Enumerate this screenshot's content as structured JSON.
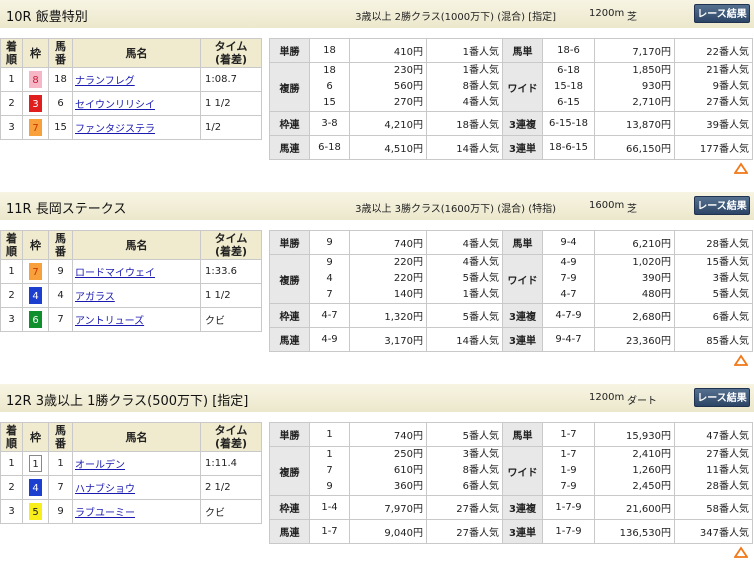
{
  "headers": {
    "finish": "着順",
    "gate": "枠",
    "horse_no": "馬番",
    "horse_name": "馬名",
    "time": "タイム(着差)",
    "finish_l1": "着",
    "finish_l2": "順",
    "horse_no_l1": "馬",
    "horse_no_l2": "番",
    "time_l1": "タイム",
    "time_l2": "(着差)"
  },
  "button_label": "レース結果",
  "colors": {
    "header_bg": "#f0ebcf",
    "button_bg": "#2c4566",
    "link": "#1a1ab0",
    "up_icon": "#f07818"
  },
  "races": [
    {
      "title": "10R 飯豊特別",
      "conditions": "3歳以上 2勝クラス(1000万下) (混合) [指定]",
      "distance": "1200m",
      "surface": "芝",
      "results": [
        {
          "finish": "1",
          "gate": "8",
          "gate_bg": "#f6b6c6",
          "gate_fg": "#c41e3a",
          "horse_no": "18",
          "name": "ナランフレグ",
          "time": "1:08.7"
        },
        {
          "finish": "2",
          "gate": "3",
          "gate_bg": "#e01e1e",
          "gate_fg": "#ffffff",
          "horse_no": "6",
          "name": "セイウンリリシイ",
          "time": "1 1/2"
        },
        {
          "finish": "3",
          "gate": "7",
          "gate_bg": "#f7a03c",
          "gate_fg": "#c83800",
          "horse_no": "15",
          "name": "ファンタジステラ",
          "time": "1/2"
        }
      ],
      "payouts": {
        "tansho": {
          "label": "単勝",
          "combos": [
            "18"
          ],
          "yen": [
            "410円"
          ],
          "pop": [
            "1番人気"
          ]
        },
        "fukusho": {
          "label": "複勝",
          "combos": [
            "18",
            "6",
            "15"
          ],
          "yen": [
            "230円",
            "560円",
            "270円"
          ],
          "pop": [
            "1番人気",
            "8番人気",
            "4番人気"
          ]
        },
        "wakuren": {
          "label": "枠連",
          "combos": [
            "3-8"
          ],
          "yen": [
            "4,210円"
          ],
          "pop": [
            "18番人気"
          ]
        },
        "umaren": {
          "label": "馬連",
          "combos": [
            "6-18"
          ],
          "yen": [
            "4,510円"
          ],
          "pop": [
            "14番人気"
          ]
        },
        "umatan": {
          "label": "馬単",
          "combos": [
            "18-6"
          ],
          "yen": [
            "7,170円"
          ],
          "pop": [
            "22番人気"
          ]
        },
        "wide": {
          "label": "ワイド",
          "combos": [
            "6-18",
            "15-18",
            "6-15"
          ],
          "yen": [
            "1,850円",
            "930円",
            "2,710円"
          ],
          "pop": [
            "21番人気",
            "9番人気",
            "27番人気"
          ]
        },
        "sanrenpuku": {
          "label": "3連複",
          "combos": [
            "6-15-18"
          ],
          "yen": [
            "13,870円"
          ],
          "pop": [
            "39番人気"
          ]
        },
        "sanrentan": {
          "label": "3連単",
          "combos": [
            "18-6-15"
          ],
          "yen": [
            "66,150円"
          ],
          "pop": [
            "177番人気"
          ]
        }
      }
    },
    {
      "title": "11R 長岡ステークス",
      "conditions": "3歳以上 3勝クラス(1600万下) (混合) (特指)",
      "distance": "1600m",
      "surface": "芝",
      "results": [
        {
          "finish": "1",
          "gate": "7",
          "gate_bg": "#f7a03c",
          "gate_fg": "#c83800",
          "horse_no": "9",
          "name": "ロードマイウェイ",
          "time": "1:33.6"
        },
        {
          "finish": "2",
          "gate": "4",
          "gate_bg": "#1c3fd0",
          "gate_fg": "#ffffff",
          "horse_no": "4",
          "name": "アガラス",
          "time": "1 1/2"
        },
        {
          "finish": "3",
          "gate": "6",
          "gate_bg": "#10902c",
          "gate_fg": "#ffffff",
          "horse_no": "7",
          "name": "アントリューズ",
          "time": "クビ"
        }
      ],
      "payouts": {
        "tansho": {
          "label": "単勝",
          "combos": [
            "9"
          ],
          "yen": [
            "740円"
          ],
          "pop": [
            "4番人気"
          ]
        },
        "fukusho": {
          "label": "複勝",
          "combos": [
            "9",
            "4",
            "7"
          ],
          "yen": [
            "220円",
            "220円",
            "140円"
          ],
          "pop": [
            "4番人気",
            "5番人気",
            "1番人気"
          ]
        },
        "wakuren": {
          "label": "枠連",
          "combos": [
            "4-7"
          ],
          "yen": [
            "1,320円"
          ],
          "pop": [
            "5番人気"
          ]
        },
        "umaren": {
          "label": "馬連",
          "combos": [
            "4-9"
          ],
          "yen": [
            "3,170円"
          ],
          "pop": [
            "14番人気"
          ]
        },
        "umatan": {
          "label": "馬単",
          "combos": [
            "9-4"
          ],
          "yen": [
            "6,210円"
          ],
          "pop": [
            "28番人気"
          ]
        },
        "wide": {
          "label": "ワイド",
          "combos": [
            "4-9",
            "7-9",
            "4-7"
          ],
          "yen": [
            "1,020円",
            "390円",
            "480円"
          ],
          "pop": [
            "15番人気",
            "3番人気",
            "5番人気"
          ]
        },
        "sanrenpuku": {
          "label": "3連複",
          "combos": [
            "4-7-9"
          ],
          "yen": [
            "2,680円"
          ],
          "pop": [
            "6番人気"
          ]
        },
        "sanrentan": {
          "label": "3連単",
          "combos": [
            "9-4-7"
          ],
          "yen": [
            "23,360円"
          ],
          "pop": [
            "85番人気"
          ]
        }
      }
    },
    {
      "title": "12R 3歳以上 1勝クラス(500万下) [指定]",
      "conditions": "",
      "distance": "1200m",
      "surface": "ダート",
      "results": [
        {
          "finish": "1",
          "gate": "1",
          "gate_bg": "#ffffff",
          "gate_fg": "#222222",
          "horse_no": "1",
          "name": "オールデン",
          "time": "1:11.4"
        },
        {
          "finish": "2",
          "gate": "4",
          "gate_bg": "#1c3fd0",
          "gate_fg": "#ffffff",
          "horse_no": "7",
          "name": "ハナブショウ",
          "time": "2 1/2"
        },
        {
          "finish": "3",
          "gate": "5",
          "gate_bg": "#f8ee1a",
          "gate_fg": "#222222",
          "horse_no": "9",
          "name": "ラブユーミー",
          "time": "クビ"
        }
      ],
      "payouts": {
        "tansho": {
          "label": "単勝",
          "combos": [
            "1"
          ],
          "yen": [
            "740円"
          ],
          "pop": [
            "5番人気"
          ]
        },
        "fukusho": {
          "label": "複勝",
          "combos": [
            "1",
            "7",
            "9"
          ],
          "yen": [
            "250円",
            "610円",
            "360円"
          ],
          "pop": [
            "3番人気",
            "8番人気",
            "6番人気"
          ]
        },
        "wakuren": {
          "label": "枠連",
          "combos": [
            "1-4"
          ],
          "yen": [
            "7,970円"
          ],
          "pop": [
            "27番人気"
          ]
        },
        "umaren": {
          "label": "馬連",
          "combos": [
            "1-7"
          ],
          "yen": [
            "9,040円"
          ],
          "pop": [
            "27番人気"
          ]
        },
        "umatan": {
          "label": "馬単",
          "combos": [
            "1-7"
          ],
          "yen": [
            "15,930円"
          ],
          "pop": [
            "47番人気"
          ]
        },
        "wide": {
          "label": "ワイド",
          "combos": [
            "1-7",
            "1-9",
            "7-9"
          ],
          "yen": [
            "2,410円",
            "1,260円",
            "2,450円"
          ],
          "pop": [
            "27番人気",
            "11番人気",
            "28番人気"
          ]
        },
        "sanrenpuku": {
          "label": "3連複",
          "combos": [
            "1-7-9"
          ],
          "yen": [
            "21,600円"
          ],
          "pop": [
            "58番人気"
          ]
        },
        "sanrentan": {
          "label": "3連単",
          "combos": [
            "1-7-9"
          ],
          "yen": [
            "136,530円"
          ],
          "pop": [
            "347番人気"
          ]
        }
      }
    }
  ]
}
